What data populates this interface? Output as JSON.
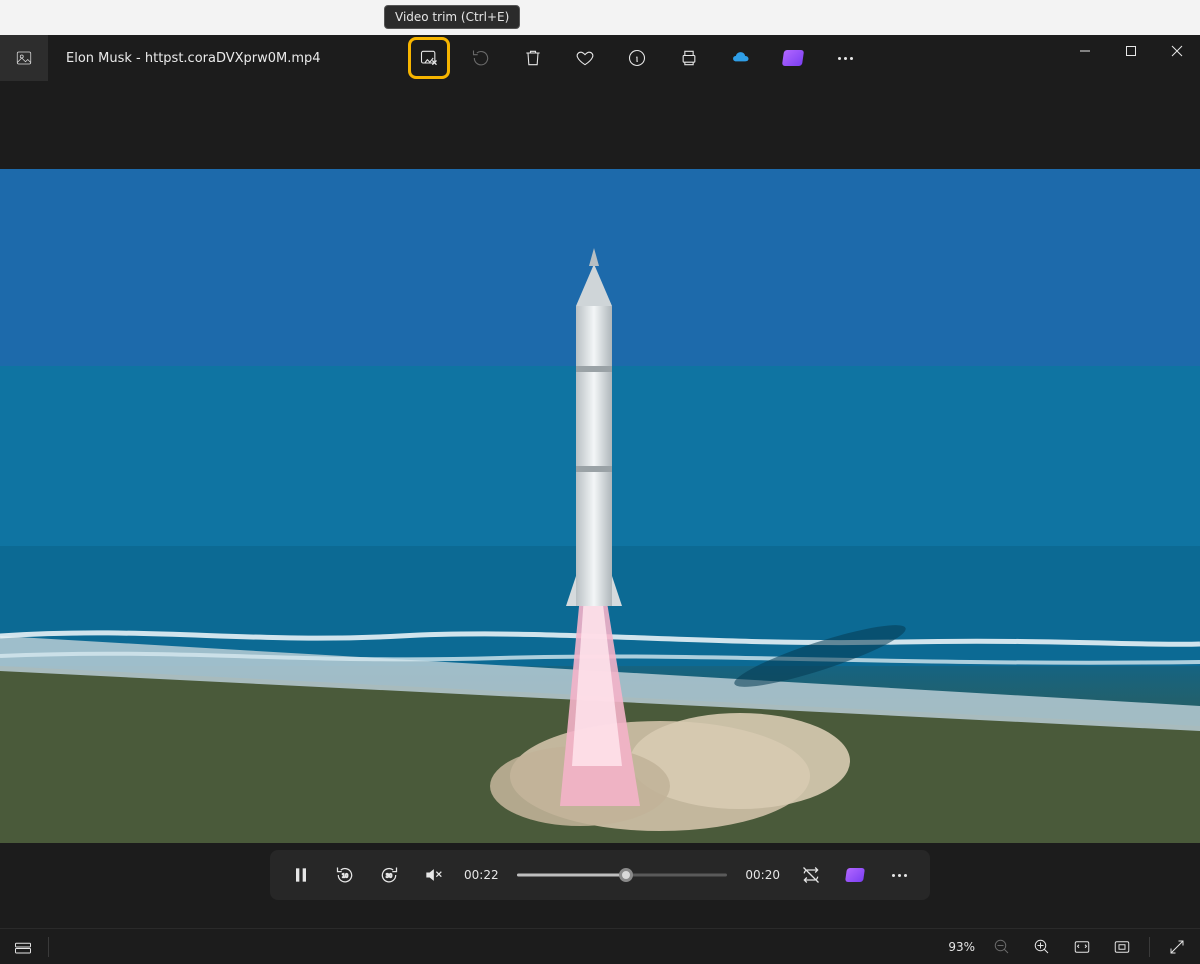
{
  "tooltip": {
    "video_trim": "Video trim (Ctrl+E)"
  },
  "titlebar": {
    "filename": "Elon Musk - httpst.coraDVXprw0M.mp4"
  },
  "toolbar": {
    "icons": {
      "video_trim": "video-trim-icon",
      "rotate": "rotate-icon",
      "delete": "delete-icon",
      "favorite": "heart-icon",
      "info": "info-icon",
      "print": "print-icon",
      "onedrive": "onedrive-icon",
      "clipchamp": "clipchamp-icon",
      "more": "more-icon"
    }
  },
  "window_controls": {
    "minimize": "minimize",
    "maximize": "maximize",
    "close": "close"
  },
  "playback": {
    "current_time": "00:22",
    "total_time": "00:20",
    "progress_percent": 52,
    "skip_back_seconds": "10",
    "skip_forward_seconds": "30"
  },
  "statusbar": {
    "zoom": "93%"
  },
  "colors": {
    "highlight": "#f7b500",
    "bg": "#1c1c1c",
    "panel": "#2b2b2b"
  }
}
